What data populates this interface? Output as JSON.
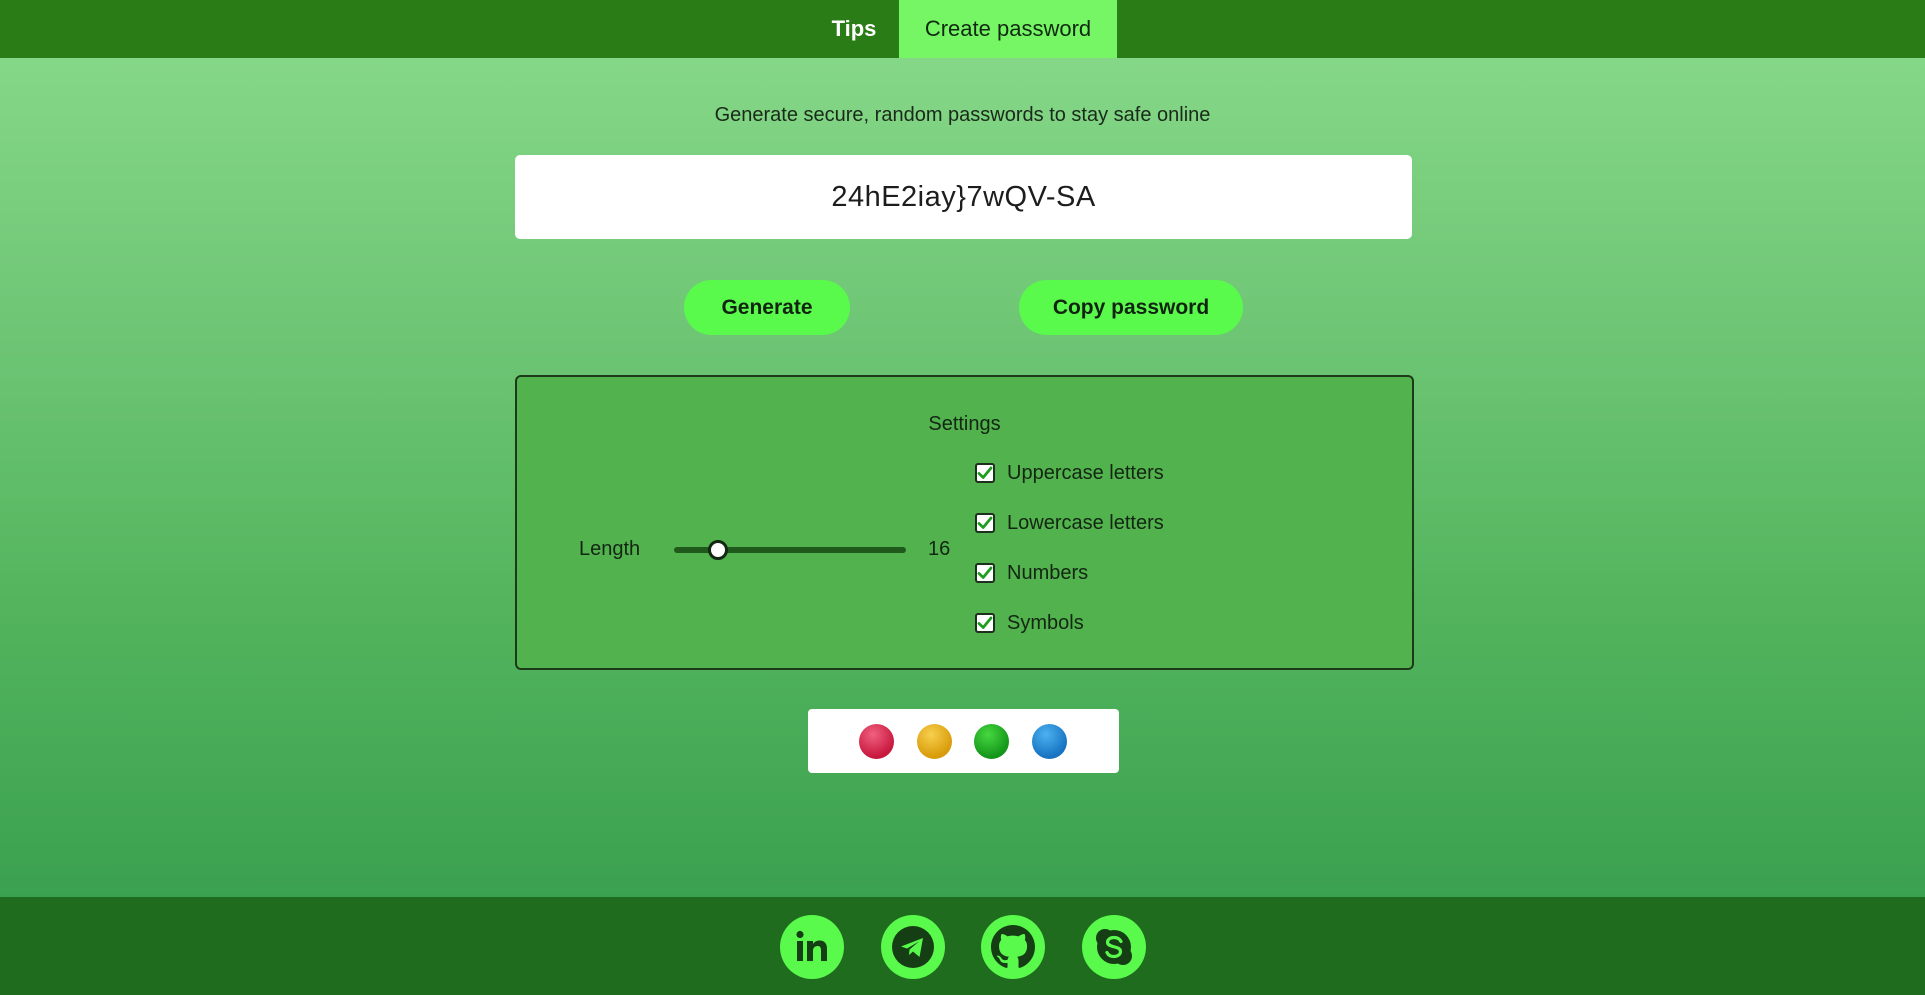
{
  "nav": {
    "tabs": [
      {
        "label": "Tips",
        "active": false
      },
      {
        "label": "Create password",
        "active": true
      }
    ]
  },
  "main": {
    "tagline": "Generate secure, random passwords to stay safe online",
    "password": "24hE2iay}7wQV-SA",
    "generate_label": "Generate",
    "copy_label": "Copy password"
  },
  "settings": {
    "title": "Settings",
    "length_label": "Length",
    "length_value": "16",
    "length_fraction": 0.19,
    "options": [
      {
        "label": "Uppercase letters",
        "checked": true
      },
      {
        "label": "Lowercase letters",
        "checked": true
      },
      {
        "label": "Numbers",
        "checked": true
      },
      {
        "label": "Symbols",
        "checked": true
      }
    ]
  },
  "themes": [
    {
      "name": "red",
      "color": "#c8183e"
    },
    {
      "name": "yellow",
      "color": "#d89b0a"
    },
    {
      "name": "green",
      "color": "#14961a"
    },
    {
      "name": "blue",
      "color": "#1773c2"
    }
  ],
  "footer": {
    "icons": [
      "linkedin-icon",
      "telegram-icon",
      "github-icon",
      "skype-icon"
    ]
  },
  "colors": {
    "nav_bg": "#2a7d16",
    "accent": "#59fa4c",
    "active_tab": "#76f565",
    "footer_bg": "#1f6c1e"
  }
}
